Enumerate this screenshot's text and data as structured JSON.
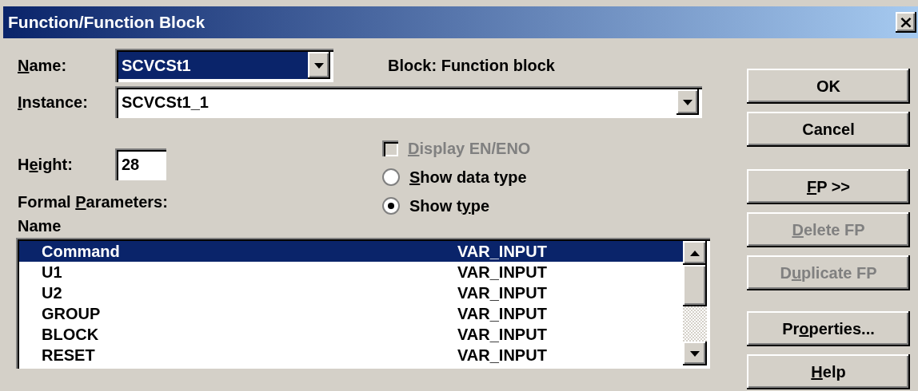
{
  "window": {
    "title": "Function/Function Block",
    "close": "×"
  },
  "name_field": {
    "label": {
      "key": "N",
      "post": "ame:"
    },
    "value": "SCVCSt1",
    "selected": true
  },
  "block_info": "Block: Function block",
  "instance_field": {
    "label": {
      "key": "I",
      "post": "nstance:"
    },
    "value": "SCVCSt1_1"
  },
  "height_field": {
    "label": {
      "pre": "H",
      "key": "e",
      "post": "ight:"
    },
    "value": "28"
  },
  "display_en_eno": {
    "label": {
      "key": "D",
      "post": "isplay EN/ENO"
    },
    "checked": false,
    "disabled": true
  },
  "show_options": [
    {
      "label": {
        "key": "S",
        "post": "how data type"
      },
      "selected": false
    },
    {
      "label": {
        "pre": "Show t",
        "key": "y",
        "post": "pe"
      },
      "selected": true
    }
  ],
  "formal_parameters_label": {
    "pre": "Formal ",
    "key": "P",
    "post": "arameters:"
  },
  "list_header": "Name",
  "parameters": [
    {
      "name": "Command",
      "type": "VAR_INPUT",
      "selected": true
    },
    {
      "name": "U1",
      "type": "VAR_INPUT",
      "selected": false
    },
    {
      "name": "U2",
      "type": "VAR_INPUT",
      "selected": false
    },
    {
      "name": "GROUP",
      "type": "VAR_INPUT",
      "selected": false
    },
    {
      "name": "BLOCK",
      "type": "VAR_INPUT",
      "selected": false
    },
    {
      "name": "RESET",
      "type": "VAR_INPUT",
      "selected": false
    }
  ],
  "button_groups": [
    [
      {
        "label": {
          "pre": "OK"
        },
        "disabled": false
      },
      {
        "label": {
          "pre": "Cancel"
        },
        "disabled": false
      }
    ],
    [
      {
        "label": {
          "key": "F",
          "post": "P >>"
        },
        "disabled": false
      },
      {
        "label": {
          "key": "D",
          "post": "elete FP"
        },
        "disabled": true
      },
      {
        "label": {
          "pre": "D",
          "key": "u",
          "post": "plicate FP"
        },
        "disabled": true
      }
    ],
    [
      {
        "label": {
          "pre": "Pr",
          "key": "o",
          "post": "perties..."
        },
        "disabled": false
      },
      {
        "label": {
          "key": "H",
          "post": "elp"
        },
        "disabled": false
      }
    ]
  ]
}
